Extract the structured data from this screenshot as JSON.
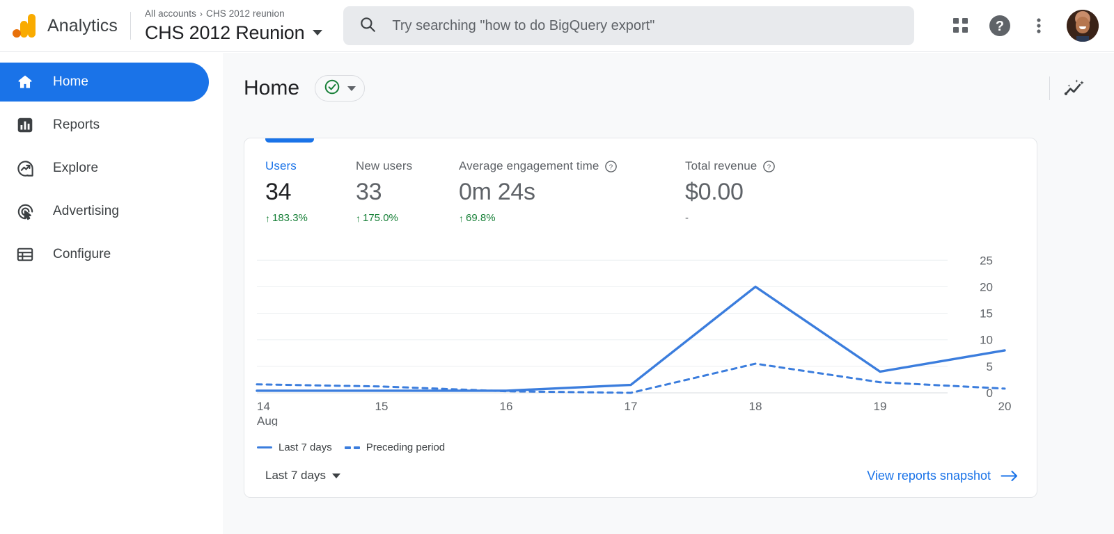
{
  "topbar": {
    "brand_name": "Analytics",
    "logo_icon": "analytics-logo",
    "breadcrumb_root": "All accounts",
    "breadcrumb_separator": "›",
    "breadcrumb_current": "CHS 2012 reunion",
    "account_title": "CHS 2012 Reunion",
    "account_caret_icon": "chevron-down-icon",
    "search": {
      "icon": "search-icon",
      "value": "",
      "placeholder": "Try searching \"how to do BigQuery export\""
    },
    "actions": [
      {
        "name": "apps-grid-icon",
        "label": "Google apps"
      },
      {
        "name": "help-icon",
        "label": "Help"
      },
      {
        "name": "more-vert-icon",
        "label": "More options"
      }
    ],
    "avatar_label": "Account"
  },
  "sidebar": {
    "items": [
      {
        "label": "Home",
        "icon": "home-icon",
        "active": true
      },
      {
        "label": "Reports",
        "icon": "reports-icon",
        "active": false
      },
      {
        "label": "Explore",
        "icon": "explore-icon",
        "active": false
      },
      {
        "label": "Advertising",
        "icon": "advertising-icon",
        "active": false
      },
      {
        "label": "Configure",
        "icon": "configure-icon",
        "active": false
      }
    ]
  },
  "page": {
    "title": "Home",
    "status_icon": "check-circle-icon",
    "status_caret_icon": "chevron-down-icon",
    "insights_icon": "insights-sparkle-icon"
  },
  "card": {
    "metrics": [
      {
        "label": "Users",
        "value": "34",
        "delta": "183.3%",
        "delta_dir": "up",
        "accent": true,
        "help": false
      },
      {
        "label": "New users",
        "value": "33",
        "delta": "175.0%",
        "delta_dir": "up",
        "accent": false,
        "help": false
      },
      {
        "label": "Average engagement time",
        "value": "0m 24s",
        "delta": "69.8%",
        "delta_dir": "up",
        "accent": false,
        "help": true
      },
      {
        "label": "Total revenue",
        "value": "$0.00",
        "delta": "-",
        "delta_dir": "none",
        "accent": false,
        "help": true
      }
    ],
    "delta_arrow_up": "↑",
    "legend": [
      {
        "label": "Last 7 days",
        "style": "solid"
      },
      {
        "label": "Preceding period",
        "style": "dashed"
      }
    ],
    "footer": {
      "date_range": "Last 7 days",
      "date_caret_icon": "chevron-down-icon",
      "snapshot_link": "View reports snapshot",
      "snapshot_arrow_icon": "arrow-right-icon"
    }
  },
  "colors": {
    "accent_blue": "#1a73e8",
    "line_blue": "#3b7ddd",
    "positive_green": "#188038",
    "logo_orange": "#f9ab00",
    "logo_deep_orange": "#e8710a",
    "canvas": "#f8f9fa"
  },
  "chart_data": {
    "type": "line",
    "title": "",
    "xlabel": "",
    "ylabel": "",
    "x": [
      "14",
      "15",
      "16",
      "17",
      "18",
      "19",
      "20"
    ],
    "x_unit_label": "Aug",
    "y_ticks": [
      0,
      5,
      10,
      15,
      20,
      25
    ],
    "ylim": [
      0,
      27
    ],
    "grid": true,
    "legend_position": "bottom-left",
    "series": [
      {
        "name": "Last 7 days",
        "style": "solid",
        "color": "#3b7ddd",
        "values": [
          0.4,
          0.4,
          0.4,
          1.5,
          20.0,
          4.0,
          8.0
        ]
      },
      {
        "name": "Preceding period",
        "style": "dashed",
        "color": "#3b7ddd",
        "values": [
          1.6,
          1.2,
          0.3,
          0.0,
          5.5,
          2.0,
          0.8
        ]
      }
    ]
  }
}
